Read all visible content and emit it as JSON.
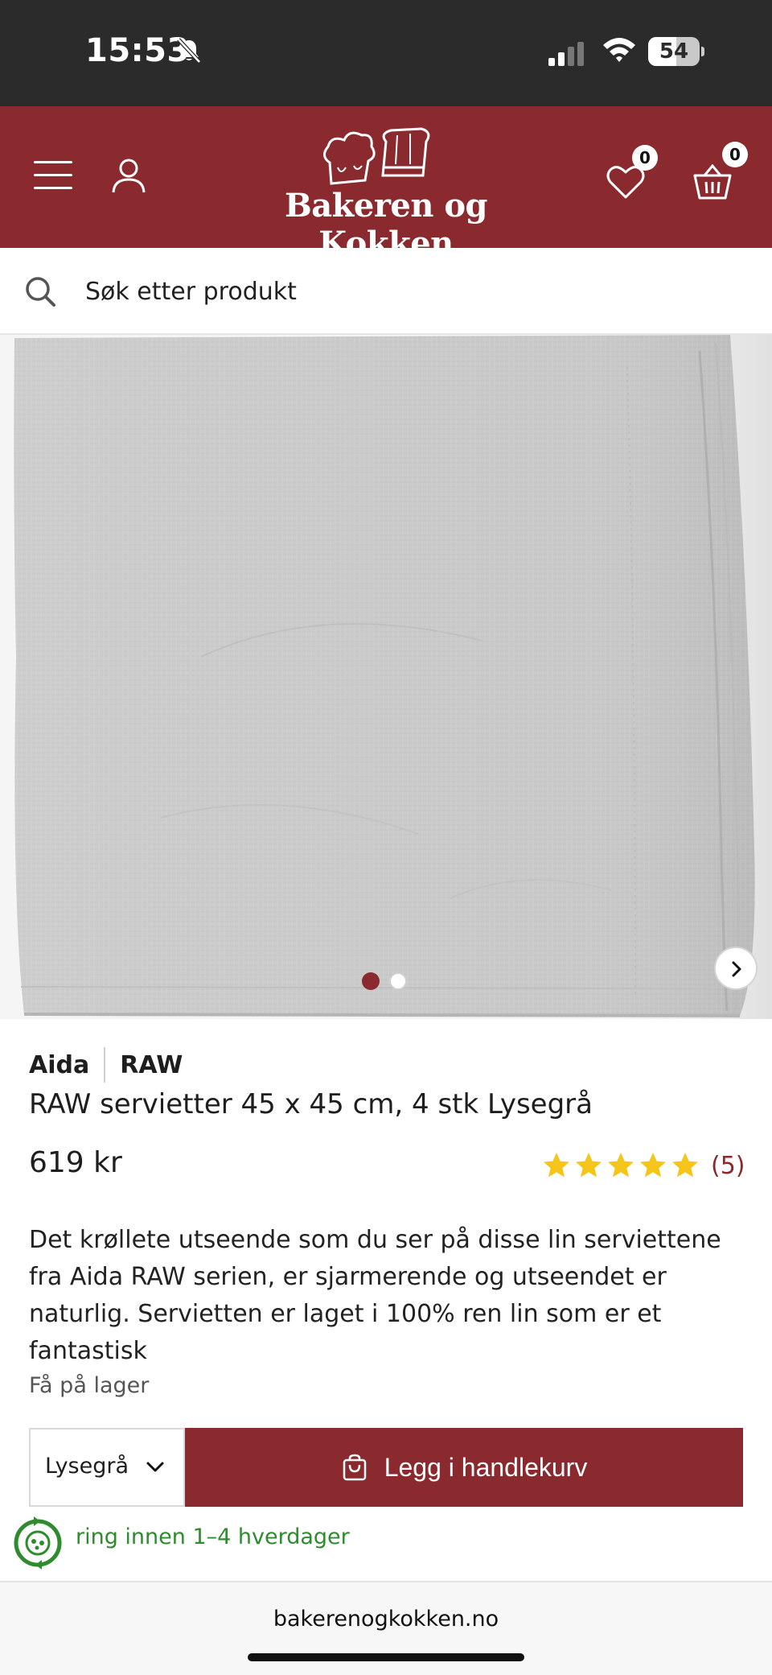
{
  "status_bar": {
    "time": "15:53",
    "battery": "54",
    "battery_level": 0.54
  },
  "header": {
    "logo_text": "Bakeren og Kokken",
    "wishlist_count": "0",
    "cart_count": "0",
    "brand_color": "#8b2a2e"
  },
  "search": {
    "placeholder": "Søk etter produkt"
  },
  "gallery": {
    "total_images": 2,
    "active_index": 1
  },
  "product": {
    "brand": "Aida",
    "series": "RAW",
    "title": "RAW servietter 45 x 45 cm, 4 stk Lysegrå",
    "price": "619 kr",
    "rating": 5,
    "review_count": "(5)",
    "description": "Det krøllete utseende som du ser på disse lin serviettene fra Aida RAW serien, er sjarmerende og utseendet er naturlig. Servietten er laget i 100% ren lin som er et fantastisk",
    "stock_status": "Få på lager"
  },
  "purchase": {
    "variant": "Lysegrå",
    "add_to_cart_label": "Legg i handlekurv"
  },
  "delivery": {
    "text": "ring innen 1–4 hverdager",
    "color": "#2e8b2e"
  },
  "browser": {
    "url": "bakerenogkokken.no"
  }
}
